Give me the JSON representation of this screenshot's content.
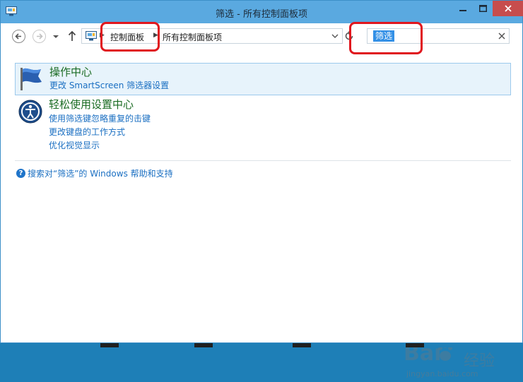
{
  "window": {
    "title": "筛选 - 所有控制面板项",
    "close_label": "✕",
    "minimize_label": "—",
    "maximize_label": "□"
  },
  "address": {
    "crumbs": [
      "控制面板",
      "所有控制面板项"
    ]
  },
  "search": {
    "value": "筛选"
  },
  "results": [
    {
      "title": "操作中心",
      "links": [
        "更改 SmartScreen 筛选器设置"
      ],
      "icon": "flag-icon"
    },
    {
      "title": "轻松使用设置中心",
      "links": [
        "使用筛选键忽略重复的击键",
        "更改键盘的工作方式",
        "优化视觉显示"
      ],
      "icon": "ease-of-access-icon"
    }
  ],
  "help": {
    "text": "搜索对“筛选”的 Windows 帮助和支持"
  },
  "watermark": {
    "logo": "Bai",
    "cn": "经验",
    "url": "jingyan.baidu.com"
  },
  "colors": {
    "titlebar": "#5aa9e0",
    "close": "#c74d4d",
    "link": "#1a6fc2",
    "title_green": "#1a6b22",
    "highlight": "#e7f3fb",
    "annotation": "#e0171e",
    "selection": "#3390e6"
  }
}
